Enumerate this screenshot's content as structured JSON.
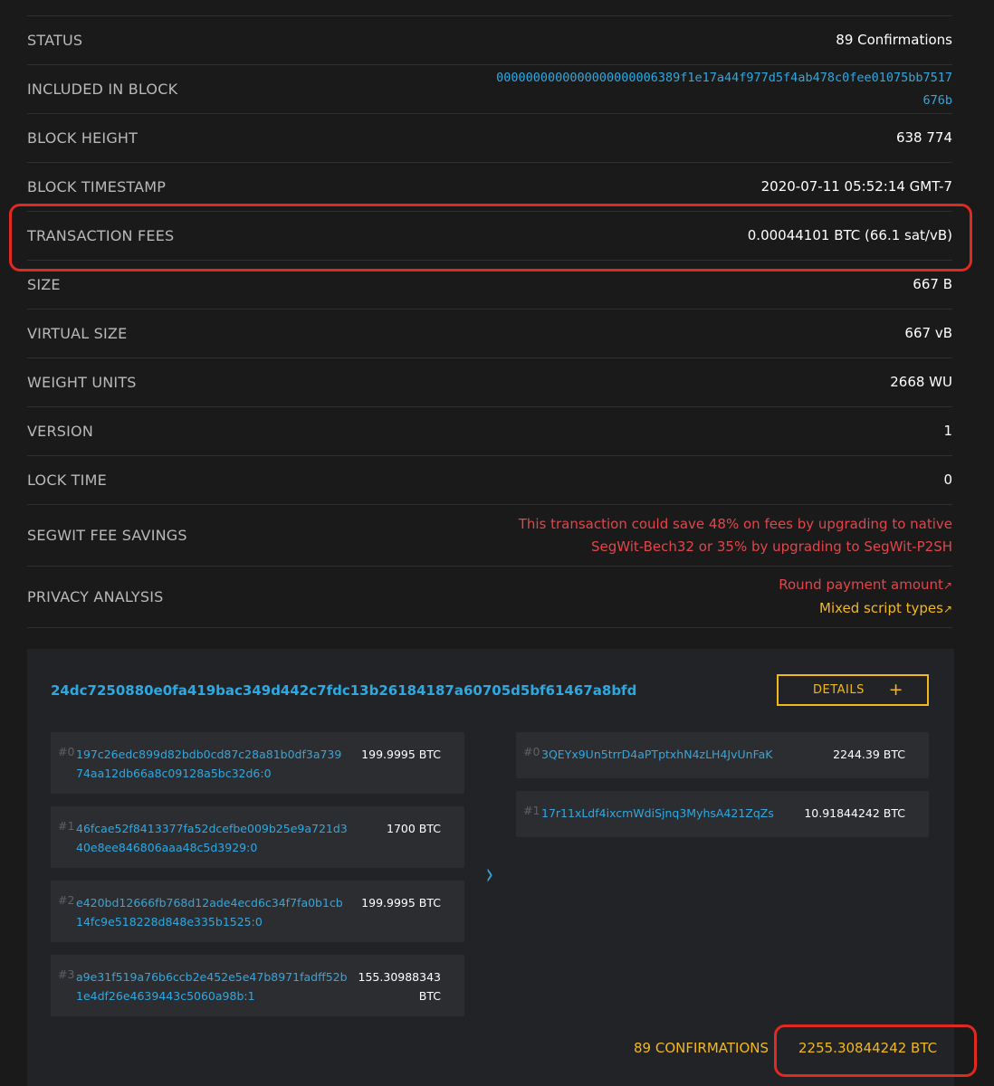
{
  "details": {
    "status": {
      "label": "STATUS",
      "value": "89 Confirmations"
    },
    "included_in_block": {
      "label": "INCLUDED IN BLOCK",
      "value": "0000000000000000000006389f1e17a44f977d5f4ab478c0fee01075bb7517676b"
    },
    "block_height": {
      "label": "BLOCK HEIGHT",
      "value": "638 774"
    },
    "block_timestamp": {
      "label": "BLOCK TIMESTAMP",
      "value": "2020-07-11 05:52:14 GMT-7"
    },
    "transaction_fees": {
      "label": "TRANSACTION FEES",
      "value": "0.00044101 BTC (66.1 sat/vB)"
    },
    "size": {
      "label": "SIZE",
      "value": "667 B"
    },
    "virtual_size": {
      "label": "VIRTUAL SIZE",
      "value": "667 vB"
    },
    "weight_units": {
      "label": "WEIGHT UNITS",
      "value": "2668 WU"
    },
    "version": {
      "label": "VERSION",
      "value": "1"
    },
    "lock_time": {
      "label": "LOCK TIME",
      "value": "0"
    },
    "segwit_fee_savings": {
      "label": "SEGWIT FEE SAVINGS",
      "value": "This transaction could save 48% on fees by upgrading to native SegWit-Bech32 or 35% by upgrading to SegWit-P2SH"
    },
    "privacy_analysis": {
      "label": "PRIVACY ANALYSIS",
      "items": [
        "Round payment amount",
        "Mixed script types"
      ],
      "arrow": "↗"
    }
  },
  "transaction": {
    "txid": "24dc7250880e0fa419bac349d442c7fdc13b26184187a60705d5bf61467a8bfd",
    "details_label": "DETAILS",
    "details_plus": "+",
    "inputs": [
      {
        "index": "#0",
        "address": "197c26edc899d82bdb0cd87c28a81b0df3a73974aa12db66a8c09128a5bc32d6:0",
        "amount": "199.9995 BTC"
      },
      {
        "index": "#1",
        "address": "46fcae52f8413377fa52dcefbe009b25e9a721d340e8ee846806aaa48c5d3929:0",
        "amount": "1700 BTC"
      },
      {
        "index": "#2",
        "address": "e420bd12666fb768d12ade4ecd6c34f7fa0b1cb14fc9e518228d848e335b1525:0",
        "amount": "199.9995 BTC"
      },
      {
        "index": "#3",
        "address": "a9e31f519a76b6ccb2e452e5e47b8971fadff52b1e4df26e4639443c5060a98b:1",
        "amount": "155.30988343 BTC"
      }
    ],
    "outputs": [
      {
        "index": "#0",
        "address": "3QEYx9Un5trrD4aPTptxhN4zLH4JvUnFaK",
        "amount": "2244.39 BTC"
      },
      {
        "index": "#1",
        "address": "17r11xLdf4ixcmWdiSjnq3MyhsA421ZqZs",
        "amount": "10.91844242 BTC"
      }
    ],
    "arrow_glyph": "›",
    "confirmations": "89 CONFIRMATIONS",
    "total": "2255.30844242 BTC"
  },
  "colors": {
    "accent_blue": "#2fa8e0",
    "accent_orange": "#f2b81d",
    "warning_red": "#e0464b",
    "highlight_box": "#e0291f"
  }
}
